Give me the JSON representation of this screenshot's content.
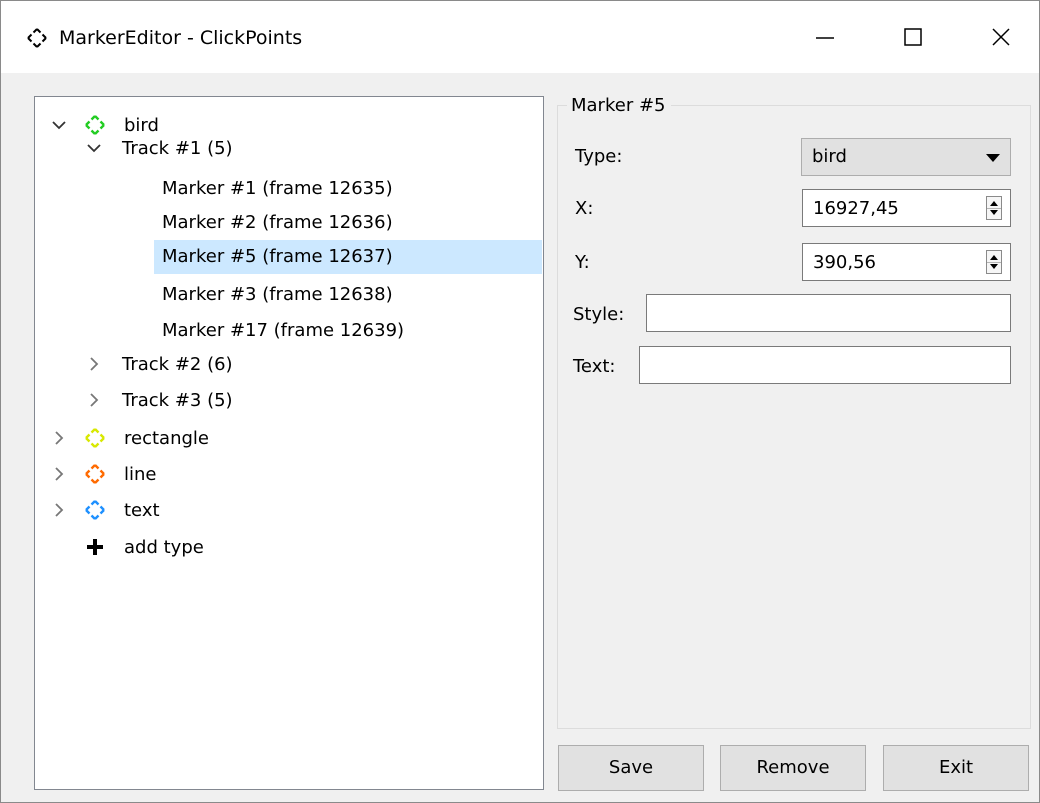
{
  "window": {
    "title": "MarkerEditor - ClickPoints",
    "app_icon": "crosshair-move-icon",
    "controls": [
      "minimize-icon",
      "maximize-icon",
      "close-icon"
    ]
  },
  "tree": {
    "nodes": [
      {
        "label": "bird",
        "icon": "crosshair-move-icon",
        "color": "#22cc22",
        "expanded": true
      },
      {
        "label": "Track #1 (5)",
        "expanded": true
      },
      {
        "label": "Marker #1 (frame 12635)"
      },
      {
        "label": "Marker #2 (frame 12636)"
      },
      {
        "label": "Marker #5 (frame 12637)",
        "selected": true
      },
      {
        "label": "Marker #3 (frame 12638)"
      },
      {
        "label": "Marker #17 (frame 12639)"
      },
      {
        "label": "Track #2 (6)",
        "expanded": false
      },
      {
        "label": "Track #3 (5)",
        "expanded": false
      },
      {
        "label": "rectangle",
        "icon": "crosshair-move-icon",
        "color": "#d8e800",
        "expanded": false
      },
      {
        "label": "line",
        "icon": "crosshair-move-icon",
        "color": "#ff6a00",
        "expanded": false
      },
      {
        "label": "text",
        "icon": "crosshair-move-icon",
        "color": "#1e90ff",
        "expanded": false
      },
      {
        "label": "add type",
        "icon": "plus-icon"
      }
    ]
  },
  "properties": {
    "title": "Marker #5",
    "type_label": "Type:",
    "type_value": "bird",
    "x_label": "X:",
    "x_value": "16927,45",
    "y_label": "Y:",
    "y_value": "390,56",
    "style_label": "Style:",
    "style_value": "",
    "text_label": "Text:",
    "text_value": ""
  },
  "buttons": {
    "save": "Save",
    "remove": "Remove",
    "exit": "Exit"
  }
}
